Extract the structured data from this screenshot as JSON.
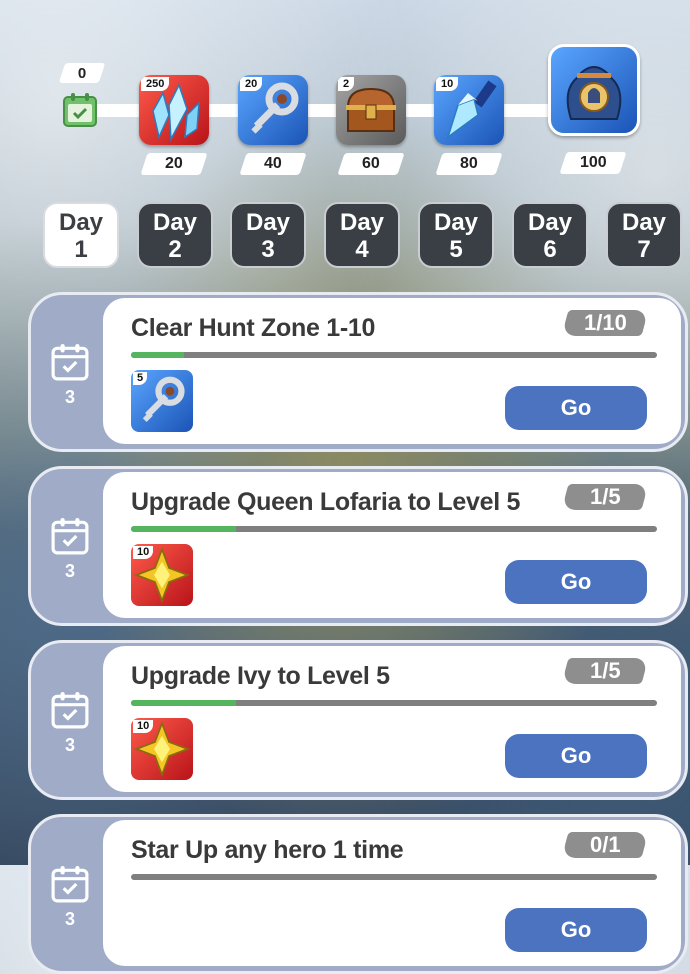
{
  "milestones": {
    "start_value": "0",
    "items": [
      {
        "qty": "250",
        "points": "20",
        "icon": "blue-crystals-icon",
        "bg": "#d0232b"
      },
      {
        "qty": "20",
        "points": "40",
        "icon": "silver-key-icon",
        "bg": "#2f6fd0"
      },
      {
        "qty": "2",
        "points": "60",
        "icon": "treasure-chest-icon",
        "bg": "#6f6f6f"
      },
      {
        "qty": "10",
        "points": "80",
        "icon": "ice-shard-icon",
        "bg": "#2f6fd0"
      },
      {
        "qty": "",
        "points": "100",
        "icon": "spartan-loot-bag-icon",
        "bg": "#2f6fd0"
      }
    ]
  },
  "tabs": [
    {
      "line1": "Day",
      "line2": "1",
      "active": true
    },
    {
      "line1": "Day",
      "line2": "2",
      "active": false
    },
    {
      "line1": "Day",
      "line2": "3",
      "active": false
    },
    {
      "line1": "Day",
      "line2": "4",
      "active": false
    },
    {
      "line1": "Day",
      "line2": "5",
      "active": false
    },
    {
      "line1": "Day",
      "line2": "6",
      "active": false
    },
    {
      "line1": "Day",
      "line2": "7",
      "active": false
    }
  ],
  "quests": [
    {
      "title": "Clear Hunt Zone 1-10",
      "progress_text": "1/10",
      "progress": 0.1,
      "points": "3",
      "reward_qty": "5",
      "reward_icon": "silver-key-icon",
      "button": "Go"
    },
    {
      "title": "Upgrade Queen Lofaria to Level 5",
      "progress_text": "1/5",
      "progress": 0.2,
      "points": "3",
      "reward_qty": "10",
      "reward_icon": "gold-star-gem-icon",
      "button": "Go"
    },
    {
      "title": "Upgrade Ivy to Level 5",
      "progress_text": "1/5",
      "progress": 0.2,
      "points": "3",
      "reward_qty": "10",
      "reward_icon": "gold-star-gem-icon",
      "button": "Go"
    },
    {
      "title": "Star Up any hero 1 time",
      "progress_text": "0/1",
      "progress": 0.0,
      "points": "3",
      "reward_qty": "",
      "reward_icon": "",
      "button": "Go"
    }
  ]
}
